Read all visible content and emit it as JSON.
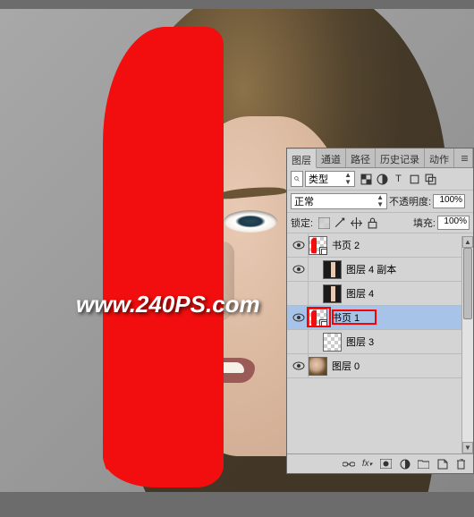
{
  "watermark": "www.240PS.com",
  "panel": {
    "tabs": [
      "图层",
      "通道",
      "路径",
      "历史记录",
      "动作"
    ],
    "active_tab": 0,
    "filter_label": "类型",
    "blend_mode": "正常",
    "opacity_label": "不透明度:",
    "opacity_value": "100%",
    "lock_label": "锁定:",
    "fill_label": "填充:",
    "fill_value": "100%"
  },
  "layers": [
    {
      "visible": true,
      "name": "书页 2",
      "thumb": "trans-red",
      "smart": true,
      "indent": 0,
      "selected": false
    },
    {
      "visible": true,
      "name": "图层 4 副本",
      "thumb": "black",
      "smart": false,
      "indent": 1,
      "selected": false
    },
    {
      "visible": false,
      "name": "图层 4",
      "thumb": "black",
      "smart": false,
      "indent": 1,
      "selected": false
    },
    {
      "visible": true,
      "name": "书页 1",
      "thumb": "trans-red",
      "smart": true,
      "indent": 0,
      "selected": true
    },
    {
      "visible": false,
      "name": "图层 3",
      "thumb": "trans",
      "smart": false,
      "indent": 1,
      "selected": false
    },
    {
      "visible": true,
      "name": "图层 0",
      "thumb": "photo",
      "smart": false,
      "indent": 0,
      "selected": false
    }
  ],
  "footer_icons": [
    "link",
    "fx",
    "mask",
    "adjust",
    "group",
    "new",
    "trash"
  ]
}
